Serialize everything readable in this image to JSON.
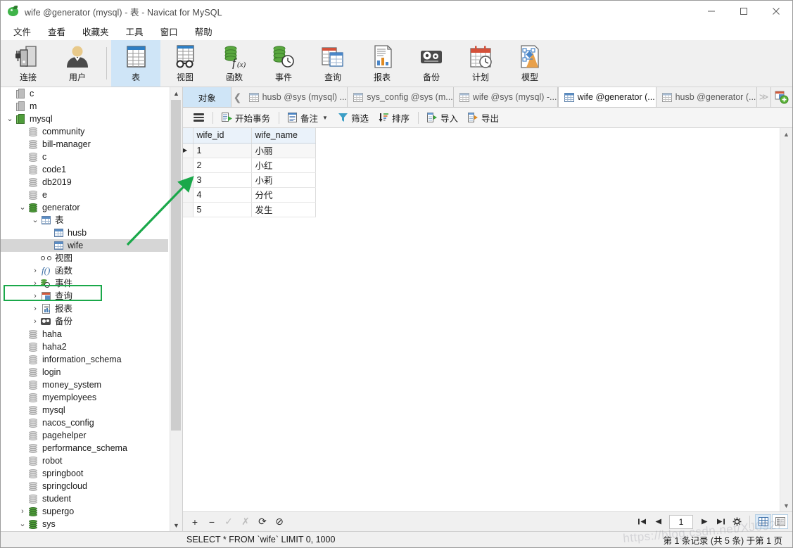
{
  "window": {
    "title": "wife @generator (mysql) - 表 - Navicat for MySQL",
    "logo_icon": "navicat-bean-icon",
    "minimize_icon": "minimize-icon",
    "maximize_icon": "maximize-icon",
    "close_icon": "close-icon"
  },
  "menubar": {
    "items": [
      {
        "label": "文件"
      },
      {
        "label": "查看"
      },
      {
        "label": "收藏夹"
      },
      {
        "label": "工具"
      },
      {
        "label": "窗口"
      },
      {
        "label": "帮助"
      }
    ]
  },
  "toolbar": {
    "items": [
      {
        "label": "连接",
        "icon": "connection-icon",
        "active": false
      },
      {
        "label": "用户",
        "icon": "user-icon",
        "active": false
      },
      {
        "label": "表",
        "icon": "table-icon",
        "active": true
      },
      {
        "label": "视图",
        "icon": "view-icon",
        "active": false
      },
      {
        "label": "函数",
        "icon": "function-icon",
        "active": false
      },
      {
        "label": "事件",
        "icon": "event-icon",
        "active": false
      },
      {
        "label": "查询",
        "icon": "query-icon",
        "active": false
      },
      {
        "label": "报表",
        "icon": "report-icon",
        "active": false
      },
      {
        "label": "备份",
        "icon": "backup-icon",
        "active": false
      },
      {
        "label": "计划",
        "icon": "schedule-icon",
        "active": false
      },
      {
        "label": "模型",
        "icon": "model-icon",
        "active": false
      }
    ]
  },
  "sidebar": {
    "scroll_up_icon": "chevron-up-icon",
    "scroll_down_icon": "chevron-down-icon",
    "nodes": [
      {
        "label": "c",
        "indent": 1,
        "icon": "connection-icon",
        "expander": "",
        "selected": false
      },
      {
        "label": "m",
        "indent": 1,
        "icon": "connection-icon",
        "expander": "",
        "selected": false
      },
      {
        "label": "mysql",
        "indent": 1,
        "icon": "connection-green-icon",
        "expander": "v",
        "selected": false
      },
      {
        "label": "community",
        "indent": 2,
        "icon": "database-icon",
        "expander": "",
        "selected": false
      },
      {
        "label": "bill-manager",
        "indent": 2,
        "icon": "database-icon",
        "expander": "",
        "selected": false
      },
      {
        "label": "c",
        "indent": 2,
        "icon": "database-icon",
        "expander": "",
        "selected": false
      },
      {
        "label": "code1",
        "indent": 2,
        "icon": "database-icon",
        "expander": "",
        "selected": false
      },
      {
        "label": "db2019",
        "indent": 2,
        "icon": "database-icon",
        "expander": "",
        "selected": false
      },
      {
        "label": "e",
        "indent": 2,
        "icon": "database-icon",
        "expander": "",
        "selected": false
      },
      {
        "label": "generator",
        "indent": 2,
        "icon": "database-green-icon",
        "expander": "v",
        "selected": false,
        "highlighted": true
      },
      {
        "label": "表",
        "indent": 3,
        "icon": "table-icon",
        "expander": "v",
        "selected": false
      },
      {
        "label": "husb",
        "indent": 4,
        "icon": "table-icon",
        "expander": "",
        "selected": false
      },
      {
        "label": "wife",
        "indent": 4,
        "icon": "table-icon",
        "expander": "",
        "selected": true
      },
      {
        "label": "视图",
        "indent": 3,
        "icon": "view-icon",
        "expander": "",
        "selected": false
      },
      {
        "label": "函数",
        "indent": 3,
        "icon": "function-icon",
        "expander": ">",
        "selected": false
      },
      {
        "label": "事件",
        "indent": 3,
        "icon": "event-icon",
        "expander": ">",
        "selected": false
      },
      {
        "label": "查询",
        "indent": 3,
        "icon": "query-icon",
        "expander": ">",
        "selected": false
      },
      {
        "label": "报表",
        "indent": 3,
        "icon": "report-icon",
        "expander": ">",
        "selected": false
      },
      {
        "label": "备份",
        "indent": 3,
        "icon": "backup-icon",
        "expander": ">",
        "selected": false
      },
      {
        "label": "haha",
        "indent": 2,
        "icon": "database-icon",
        "expander": "",
        "selected": false
      },
      {
        "label": "haha2",
        "indent": 2,
        "icon": "database-icon",
        "expander": "",
        "selected": false
      },
      {
        "label": "information_schema",
        "indent": 2,
        "icon": "database-icon",
        "expander": "",
        "selected": false
      },
      {
        "label": "login",
        "indent": 2,
        "icon": "database-icon",
        "expander": "",
        "selected": false
      },
      {
        "label": "money_system",
        "indent": 2,
        "icon": "database-icon",
        "expander": "",
        "selected": false
      },
      {
        "label": "myemployees",
        "indent": 2,
        "icon": "database-icon",
        "expander": "",
        "selected": false
      },
      {
        "label": "mysql",
        "indent": 2,
        "icon": "database-icon",
        "expander": "",
        "selected": false
      },
      {
        "label": "nacos_config",
        "indent": 2,
        "icon": "database-icon",
        "expander": "",
        "selected": false
      },
      {
        "label": "pagehelper",
        "indent": 2,
        "icon": "database-icon",
        "expander": "",
        "selected": false
      },
      {
        "label": "performance_schema",
        "indent": 2,
        "icon": "database-icon",
        "expander": "",
        "selected": false
      },
      {
        "label": "robot",
        "indent": 2,
        "icon": "database-icon",
        "expander": "",
        "selected": false
      },
      {
        "label": "springboot",
        "indent": 2,
        "icon": "database-icon",
        "expander": "",
        "selected": false
      },
      {
        "label": "springcloud",
        "indent": 2,
        "icon": "database-icon",
        "expander": "",
        "selected": false
      },
      {
        "label": "student",
        "indent": 2,
        "icon": "database-icon",
        "expander": "",
        "selected": false
      },
      {
        "label": "supergo",
        "indent": 2,
        "icon": "database-green-icon",
        "expander": ">",
        "selected": false
      },
      {
        "label": "sys",
        "indent": 2,
        "icon": "database-green-icon",
        "expander": "v",
        "selected": false
      }
    ]
  },
  "tabstrip": {
    "object_tab": "对象",
    "scroll_left_icon": "chevron-left-icon",
    "scroll_right_icon": "chevrons-right-icon",
    "new_tab_icon": "new-query-tab-icon",
    "tabs": [
      {
        "label": "husb @sys (mysql) ...",
        "icon": "table-icon",
        "active": false
      },
      {
        "label": "sys_config @sys (m...",
        "icon": "table-icon",
        "active": false
      },
      {
        "label": "wife @sys (mysql) -...",
        "icon": "table-icon",
        "active": false
      },
      {
        "label": "wife @generator (...",
        "icon": "table-icon",
        "active": true
      },
      {
        "label": "husb @generator (...",
        "icon": "table-icon",
        "active": false
      }
    ]
  },
  "actions": {
    "menu_icon": "hamburger-icon",
    "items": [
      {
        "label": "开始事务",
        "icon": "begin-transaction-icon",
        "dropdown": false
      },
      {
        "label": "备注",
        "icon": "note-icon",
        "dropdown": true
      },
      {
        "label": "筛选",
        "icon": "filter-icon",
        "dropdown": false
      },
      {
        "label": "排序",
        "icon": "sort-icon",
        "dropdown": false
      },
      {
        "label": "导入",
        "icon": "import-icon",
        "dropdown": false
      },
      {
        "label": "导出",
        "icon": "export-icon",
        "dropdown": false
      }
    ]
  },
  "grid": {
    "columns": [
      "wife_id",
      "wife_name"
    ],
    "rows": [
      {
        "wife_id": "1",
        "wife_name": "小丽",
        "current": true
      },
      {
        "wife_id": "2",
        "wife_name": "小红",
        "current": false
      },
      {
        "wife_id": "3",
        "wife_name": "小莉",
        "current": false
      },
      {
        "wife_id": "4",
        "wife_name": "分代",
        "current": false
      },
      {
        "wife_id": "5",
        "wife_name": "发生",
        "current": false
      }
    ],
    "row_marker_icon": "current-row-arrow-icon"
  },
  "gridfoot": {
    "buttons": [
      {
        "icon": "add-record-icon",
        "glyph": "+",
        "disabled": false
      },
      {
        "icon": "delete-record-icon",
        "glyph": "−",
        "disabled": false
      },
      {
        "icon": "apply-change-icon",
        "glyph": "✓",
        "disabled": true
      },
      {
        "icon": "cancel-change-icon",
        "glyph": "✗",
        "disabled": true
      },
      {
        "icon": "refresh-icon",
        "glyph": "⟳",
        "disabled": false
      },
      {
        "icon": "stop-icon",
        "glyph": "⊘",
        "disabled": false
      }
    ],
    "nav": {
      "first_icon": "first-page-icon",
      "prev_icon": "prev-page-icon",
      "page_value": "1",
      "next_icon": "next-page-icon",
      "last_icon": "last-page-icon",
      "settings_icon": "gear-icon"
    },
    "viewmodes": [
      {
        "icon": "grid-view-icon",
        "active": true
      },
      {
        "icon": "form-view-icon",
        "active": false
      }
    ]
  },
  "statusbar": {
    "sql": "SELECT * FROM `wife` LIMIT 0, 1000",
    "record_info": "第 1 条记录 (共 5 条) 于第 1 页"
  },
  "annotation": {
    "color": "#1aa84a",
    "watermark": "https://blog.csdn.net/XJ0927"
  }
}
